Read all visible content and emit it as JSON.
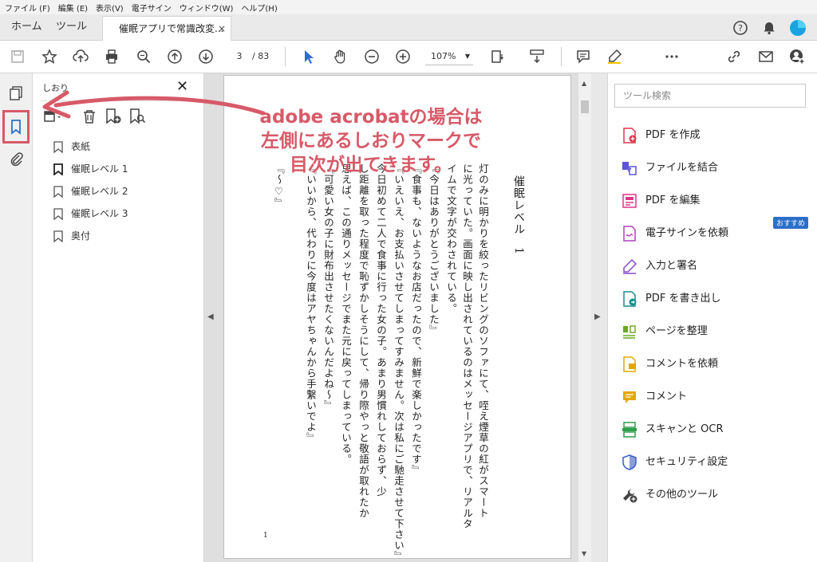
{
  "menu": [
    "ファイル (F)",
    "編集 (E)",
    "表示(V)",
    "電子サイン",
    "ウィンドウ(W)",
    "ヘルプ(H)"
  ],
  "tabs": {
    "home": "ホーム",
    "tools": "ツール",
    "doc": "催眠アプリで常識改変...",
    "close": "×"
  },
  "toolbar": {
    "page_current": "3",
    "page_sep": "/",
    "page_total": "83",
    "zoom": "107%"
  },
  "bookmarks": {
    "title": "しおり",
    "close": "✕",
    "items": [
      "表紙",
      "催眠レベル 1",
      "催眠レベル 2",
      "催眠レベル 3",
      "奥付"
    ]
  },
  "document": {
    "title": "催眠レベル　1",
    "columns": [
      "灯のみに明かりを絞ったリビングのソファにて、咥え煙草の紅がスマート",
      "に光っていた。画面に映し出されているのはメッセージアプリで、リアルタ",
      "イムで文字が交わされている。",
      "『今日はありがとうございました』",
      "『食事も、ないようなお店だったので、新鮮で楽しかったです』",
      "『いえいえ、お支払いさせてしまってすみません。次は私にご馳走させて下さい』",
      "今日初めて二人で食事に行った女の子。あまり男慣れしておらず、少",
      "し距離を取った程度で恥ずかしそうにして、帰り際やっと敬語が取れたか",
      "思えば、この通りメッセージでまた元に戻ってしまっている。",
      "『可愛い女の子に財布出させたくないんだよね〜』",
      "『いいから、代わりに今度はアヤちゃんから手繋いでよ』",
      "『〜♡』"
    ],
    "page_number": "1"
  },
  "annotation": [
    "adobe acrobatの場合は",
    "左側にあるしおりマークで",
    "目次が出てきます。"
  ],
  "tools": {
    "search_placeholder": "ツール検索",
    "recommend": "おすすめ",
    "items": [
      "PDF を作成",
      "ファイルを結合",
      "PDF を編集",
      "電子サインを依頼",
      "入力と署名",
      "PDF を書き出し",
      "ページを整理",
      "コメントを依頼",
      "コメント",
      "スキャンと OCR",
      "セキュリティ設定",
      "その他のツール"
    ]
  },
  "colors": {
    "accent": "#d75a68",
    "blue": "#2c6fc8"
  }
}
